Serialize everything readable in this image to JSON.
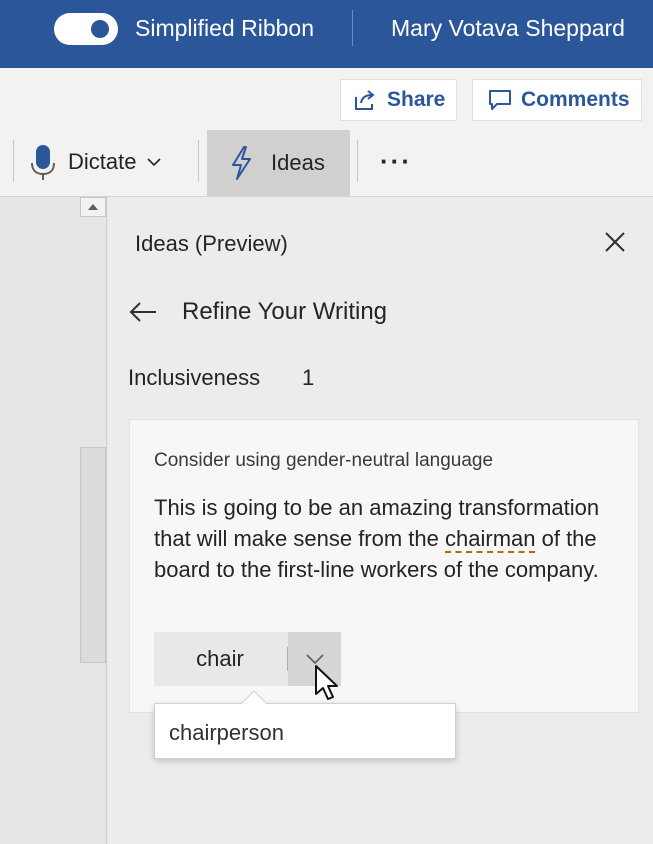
{
  "titlebar": {
    "toggle_label": "Simplified Ribbon",
    "toggle_on": true,
    "user_name": "Mary Votava Sheppard"
  },
  "toolbar": {
    "share_label": "Share",
    "comments_label": "Comments",
    "dictate_label": "Dictate",
    "ideas_label": "Ideas",
    "more_label": "···"
  },
  "pane": {
    "title": "Ideas (Preview)",
    "section_title": "Refine Your Writing",
    "category_label": "Inclusiveness",
    "category_count": "1",
    "card": {
      "heading": "Consider using gender-neutral language",
      "text_before": "This is going to be an amazing transformation that will make sense from the ",
      "flagged_word": "chairman",
      "text_after": " of the board to the first-line workers of the company.",
      "suggestion": "chair",
      "alternative": "chairperson"
    }
  },
  "colors": {
    "accent": "#2b579a",
    "flag_underline": "#b46b00",
    "pane_background": "#ececec"
  },
  "icons": [
    "share-icon",
    "comment-icon",
    "microphone-icon",
    "lightning-icon",
    "close-icon",
    "back-arrow-icon",
    "chevron-down-icon",
    "scroll-up-arrow-icon",
    "mouse-pointer-icon"
  ]
}
